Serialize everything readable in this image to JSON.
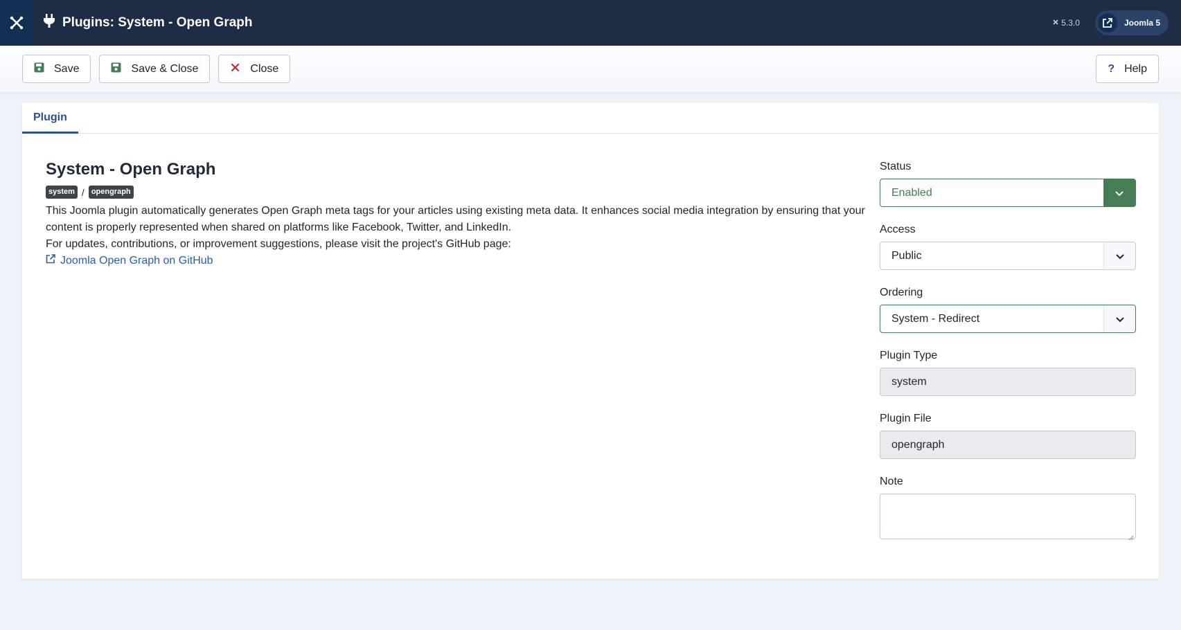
{
  "header": {
    "title": "Plugins: System - Open Graph",
    "version": "5.3.0",
    "site_button": "Joomla 5",
    "brand_icon": "joomla-logo-icon",
    "title_icon": "plug-icon"
  },
  "toolbar": {
    "save_label": "Save",
    "save_close_label": "Save & Close",
    "close_label": "Close",
    "help_label": "Help"
  },
  "tabs": [
    {
      "label": "Plugin",
      "active": true
    }
  ],
  "plugin": {
    "name": "System - Open Graph",
    "badges": [
      "system",
      "opengraph"
    ],
    "badge_separator": "/",
    "description_1": "This Joomla plugin automatically generates Open Graph meta tags for your articles using existing meta data. It enhances social media integration by ensuring that your content is properly represented when shared on platforms like Facebook, Twitter, and LinkedIn.",
    "description_2": "For updates, contributions, or improvement suggestions, please visit the project's GitHub page:",
    "link_label": "Joomla Open Graph on GitHub"
  },
  "fields": {
    "status": {
      "label": "Status",
      "value": "Enabled"
    },
    "access": {
      "label": "Access",
      "value": "Public"
    },
    "ordering": {
      "label": "Ordering",
      "value": "System - Redirect"
    },
    "plugin_type": {
      "label": "Plugin Type",
      "value": "system"
    },
    "plugin_file": {
      "label": "Plugin File",
      "value": "opengraph"
    },
    "note": {
      "label": "Note",
      "value": ""
    }
  },
  "colors": {
    "header_bg": "#1e2c45",
    "accent_blue": "#2a5193",
    "success_green": "#457d54",
    "danger_red": "#c52827"
  }
}
